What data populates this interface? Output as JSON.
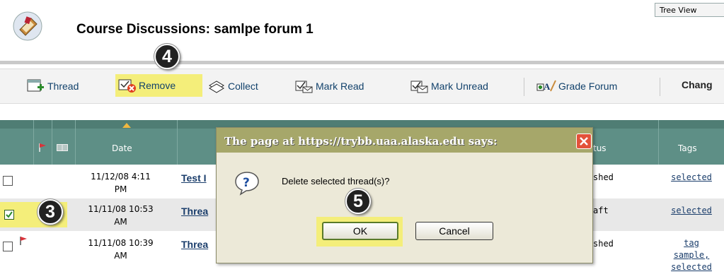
{
  "header": {
    "title": "Course Discussions: samlpe forum 1",
    "tree_view_label": "Tree View",
    "icon": "forum-icon"
  },
  "toolbar": {
    "items": [
      {
        "label": "Thread",
        "icon": "new-thread-icon"
      },
      {
        "label": "Remove",
        "icon": "remove-icon",
        "highlighted": true
      },
      {
        "label": "Collect",
        "icon": "collect-icon"
      },
      {
        "label": "Mark Read",
        "icon": "mark-read-icon"
      },
      {
        "label": "Mark Unread",
        "icon": "mark-unread-icon"
      },
      {
        "label": "Grade Forum",
        "icon": "grade-forum-icon"
      }
    ],
    "change_label": "Chang"
  },
  "steps": {
    "step3": "3",
    "step4": "4",
    "step5": "5"
  },
  "table": {
    "headers": {
      "date": "Date",
      "status": "tus",
      "tags": "Tags"
    },
    "rows": [
      {
        "checked": false,
        "flag": false,
        "date": "11/12/08 4:11",
        "time_suffix": "PM",
        "thread": "Test I",
        "status": "shed",
        "tags": [
          "selected"
        ]
      },
      {
        "checked": true,
        "flag": false,
        "date": "11/11/08 10:53",
        "time_suffix": "AM",
        "thread": "Threa",
        "status": "aft",
        "tags": [
          "selected"
        ]
      },
      {
        "checked": false,
        "flag": true,
        "date": "11/11/08 10:39",
        "time_suffix": "AM",
        "thread": "Threa",
        "status": "shed",
        "tags": [
          "tag",
          "sample",
          "selected"
        ]
      }
    ],
    "tag_separator": ","
  },
  "dialog": {
    "title": "The page at https://trybb.uaa.alaska.edu says:",
    "message": "Delete selected thread(s)?",
    "ok_label": "OK",
    "cancel_label": "Cancel"
  },
  "colors": {
    "table_header": "#5e8f86",
    "highlight": "#f4ee7a",
    "dialog_title": "#a6a76a",
    "link": "#1a3d6b"
  }
}
